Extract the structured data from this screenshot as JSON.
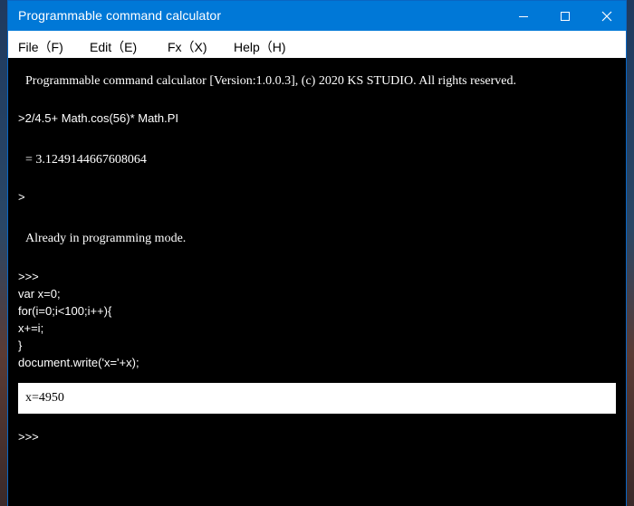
{
  "window": {
    "title": "Programmable command calculator",
    "accent_color": "#0078d7"
  },
  "title_buttons": {
    "minimize_icon": "minimize-icon",
    "maximize_icon": "maximize-icon",
    "close_icon": "close-icon"
  },
  "menu": {
    "items": [
      "File（F)",
      "Edit（E)",
      "Fx（X)",
      "Help（H)"
    ]
  },
  "console": {
    "banner": "Programmable command calculator [Version:1.0.0.3], (c) 2020 KS STUDIO. All rights reserved.",
    "input_expression": ">2/4.5+ Math.cos(56)* Math.PI",
    "result": "= 3.1249144667608064",
    "prompt": ">",
    "mode_message": "Already in programming mode.",
    "program_prompt": ">>>",
    "code_lines": [
      "var x=0;",
      "for(i=0;i<100;i++){",
      "x+=i;",
      "}",
      "document.write('x='+x);"
    ],
    "program_output": "x=4950",
    "final_prompt": ">>>"
  }
}
